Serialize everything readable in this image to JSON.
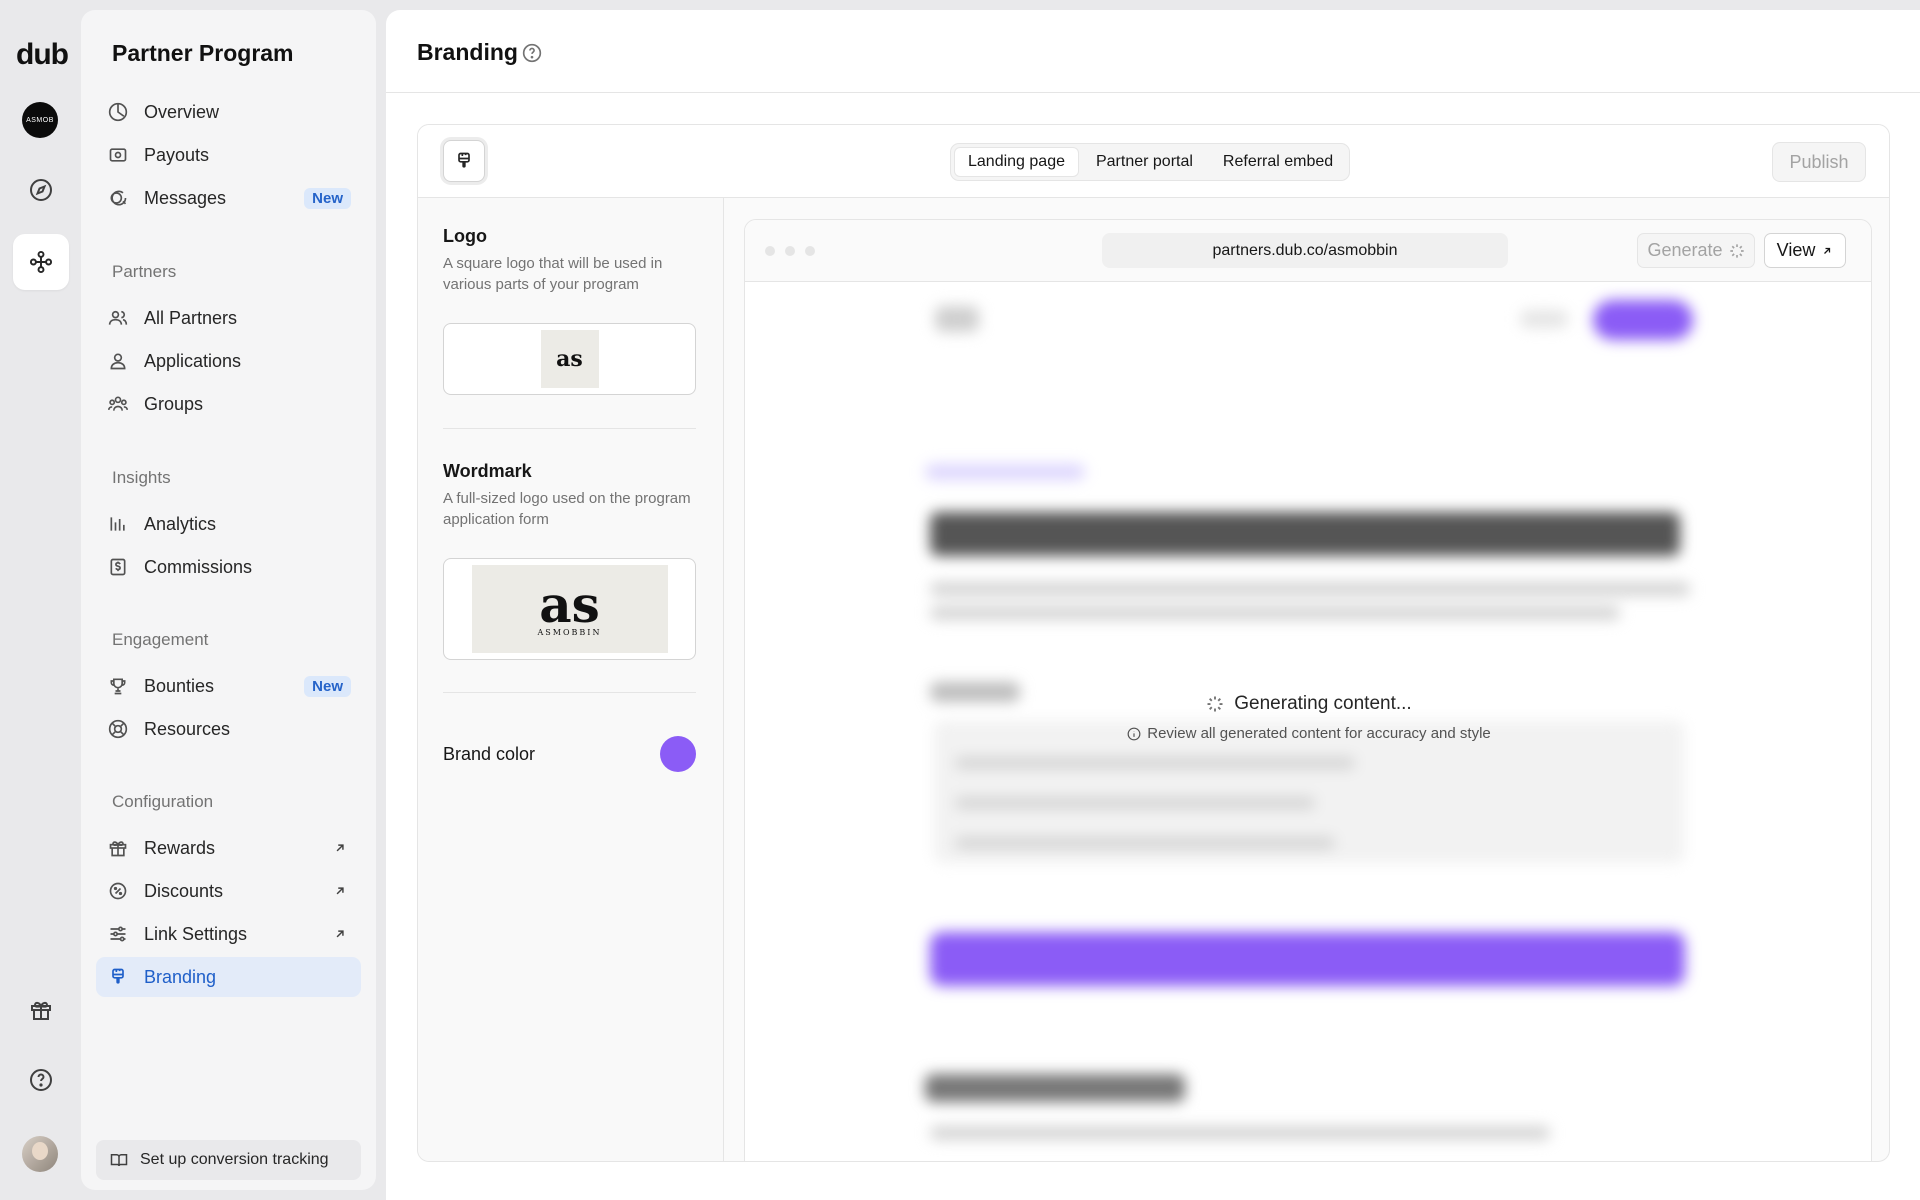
{
  "rail": {
    "logo": "dub",
    "workspace_initials": "ASMOB"
  },
  "sidebar": {
    "title": "Partner Program",
    "items_top": [
      {
        "label": "Overview",
        "icon": "overview-icon"
      },
      {
        "label": "Payouts",
        "icon": "payouts-icon"
      },
      {
        "label": "Messages",
        "icon": "messages-icon",
        "badge": "New"
      }
    ],
    "partners": {
      "heading": "Partners",
      "items": [
        {
          "label": "All Partners",
          "icon": "users-icon"
        },
        {
          "label": "Applications",
          "icon": "user-icon"
        },
        {
          "label": "Groups",
          "icon": "groups-icon"
        }
      ]
    },
    "insights": {
      "heading": "Insights",
      "items": [
        {
          "label": "Analytics",
          "icon": "analytics-icon"
        },
        {
          "label": "Commissions",
          "icon": "commissions-icon"
        }
      ]
    },
    "engagement": {
      "heading": "Engagement",
      "items": [
        {
          "label": "Bounties",
          "icon": "trophy-icon",
          "badge": "New"
        },
        {
          "label": "Resources",
          "icon": "resources-icon"
        }
      ]
    },
    "configuration": {
      "heading": "Configuration",
      "items": [
        {
          "label": "Rewards",
          "icon": "gift-icon"
        },
        {
          "label": "Discounts",
          "icon": "discount-icon"
        },
        {
          "label": "Link Settings",
          "icon": "sliders-icon"
        },
        {
          "label": "Branding",
          "icon": "brush-icon"
        }
      ]
    },
    "setup_label": "Set up conversion tracking"
  },
  "header": {
    "title": "Branding"
  },
  "toolbar": {
    "tabs": [
      "Landing page",
      "Partner portal",
      "Referral embed"
    ],
    "active_tab": "Landing page",
    "publish_label": "Publish"
  },
  "branding": {
    "logo_title": "Logo",
    "logo_desc": "A square logo that will be used in various parts of your program",
    "wordmark_title": "Wordmark",
    "wordmark_desc": "A full-sized logo used on the program application form",
    "brand_color_label": "Brand color",
    "brand_color": "#8b5cf6",
    "logo_text": "as",
    "wordmark_text": "as",
    "wordmark_sub": "ASMOBBIN"
  },
  "preview": {
    "url": "partners.dub.co/asmobbin",
    "generate_label": "Generate",
    "view_label": "View",
    "generating_text": "Generating content...",
    "review_note": "Review all generated content for accuracy and style"
  },
  "colors": {
    "accent": "#1f5fc9",
    "brand": "#8b5cf6"
  }
}
